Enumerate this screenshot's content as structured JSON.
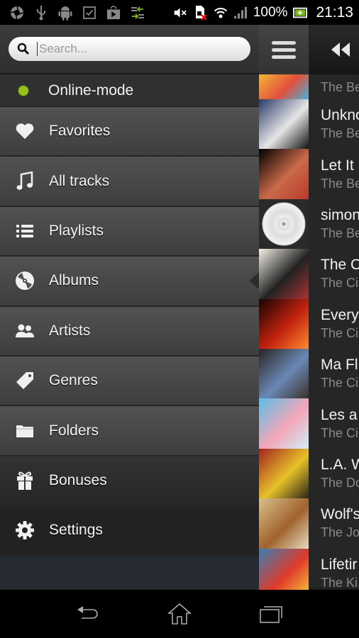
{
  "status_bar": {
    "left_icons": [
      "aperture-icon",
      "usb-icon",
      "android-icon",
      "checkbox-icon",
      "play-store-icon",
      "transfer-icon"
    ],
    "battery_percent": "100%",
    "time": "21:13",
    "right_icons": [
      "mute-icon",
      "no-sim-icon",
      "wifi-icon",
      "signal-icon",
      "battery-charging-icon"
    ]
  },
  "drawer": {
    "search": {
      "placeholder": "Search...",
      "value": ""
    },
    "online_mode": {
      "label": "Online-mode",
      "status_color": "#94c11a"
    },
    "menu_items": [
      {
        "label": "Favorites",
        "icon": "heart-icon"
      },
      {
        "label": "All tracks",
        "icon": "music-note-icon"
      },
      {
        "label": "Playlists",
        "icon": "list-icon"
      },
      {
        "label": "Albums",
        "icon": "disc-icon",
        "active": true
      },
      {
        "label": "Artists",
        "icon": "people-icon"
      },
      {
        "label": "Genres",
        "icon": "tag-icon"
      },
      {
        "label": "Folders",
        "icon": "folder-icon"
      },
      {
        "label": "Bonuses",
        "icon": "gift-icon"
      },
      {
        "label": "Settings",
        "icon": "gear-icon"
      }
    ]
  },
  "content": {
    "toolbar": {
      "menu_icon": "hamburger-icon",
      "back_icon": "rewind-icon"
    },
    "albums": [
      {
        "title": "",
        "artist": "The Be",
        "cover_colors": [
          "#f4b43a",
          "#e2503a",
          "#4cb0d8"
        ]
      },
      {
        "title": "Unkno",
        "artist": "The Be",
        "cover_colors": [
          "#2a3a6a",
          "#e6e6e6",
          "#111"
        ]
      },
      {
        "title": "Let It",
        "artist": "The Be",
        "cover_colors": [
          "#000",
          "#c96a4a",
          "#b8382a"
        ]
      },
      {
        "title": "simon",
        "artist": "The Be",
        "cover_colors": [
          "#333",
          "#f0f0f0",
          "#bbb"
        ]
      },
      {
        "title": "The C",
        "artist": "The Ci",
        "cover_colors": [
          "#f4f0e6",
          "#222",
          "#a33"
        ]
      },
      {
        "title": "Every",
        "artist": "The Ci",
        "cover_colors": [
          "#180404",
          "#c2220e",
          "#ff8a30"
        ]
      },
      {
        "title": "Ma Fl",
        "artist": "The Ci",
        "cover_colors": [
          "#2a2422",
          "#6a88b6",
          "#3a3028"
        ]
      },
      {
        "title": "Les a",
        "artist": "The Ci",
        "cover_colors": [
          "#5ac0e8",
          "#f4a6b8",
          "#d0eef8"
        ]
      },
      {
        "title": "L.A. W",
        "artist": "The Do",
        "cover_colors": [
          "#a1231e",
          "#e8c22a",
          "#2a2416"
        ]
      },
      {
        "title": "Wolf's",
        "artist": "The Jo",
        "cover_colors": [
          "#d9c089",
          "#a0622e",
          "#e8dcc0"
        ]
      },
      {
        "title": "Lifetir",
        "artist": "The Ki",
        "cover_colors": [
          "#3a7fb6",
          "#e03a2a",
          "#f6d23a"
        ]
      }
    ]
  },
  "nav_bar": {
    "buttons": [
      "back-icon",
      "home-icon",
      "recent-apps-icon"
    ]
  }
}
